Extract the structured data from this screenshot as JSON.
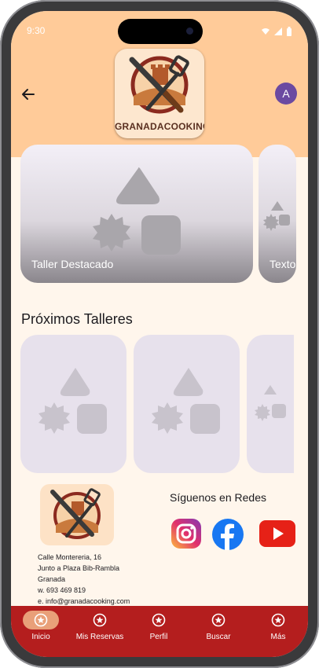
{
  "status": {
    "time": "9:30"
  },
  "header": {
    "logo_text": "GRANADACOOKING",
    "avatar_letter": "A"
  },
  "featured": {
    "items": [
      {
        "label": "Taller Destacado"
      },
      {
        "label": "Texto"
      }
    ]
  },
  "upcoming": {
    "title": "Próximos Talleres"
  },
  "footer": {
    "address_lines": [
      "Calle Montereria, 16",
      "Junto a Plaza Bib-Rambla",
      "Granada",
      "w. 693 469 819",
      "e. info@granadacooking.com"
    ],
    "social_title": "Síguenos en Redes",
    "social": [
      "instagram-icon",
      "facebook-icon",
      "youtube-icon"
    ]
  },
  "nav": {
    "items": [
      {
        "label": "Inicio",
        "active": true
      },
      {
        "label": "Mis Reservas"
      },
      {
        "label": "Perfil"
      },
      {
        "label": "Buscar"
      },
      {
        "label": "Más"
      }
    ]
  },
  "colors": {
    "header": "#ffcb99",
    "background": "#fff6ec",
    "nav": "#b41e1e",
    "nav_active": "#e9a079",
    "avatar": "#6b4aa1"
  }
}
